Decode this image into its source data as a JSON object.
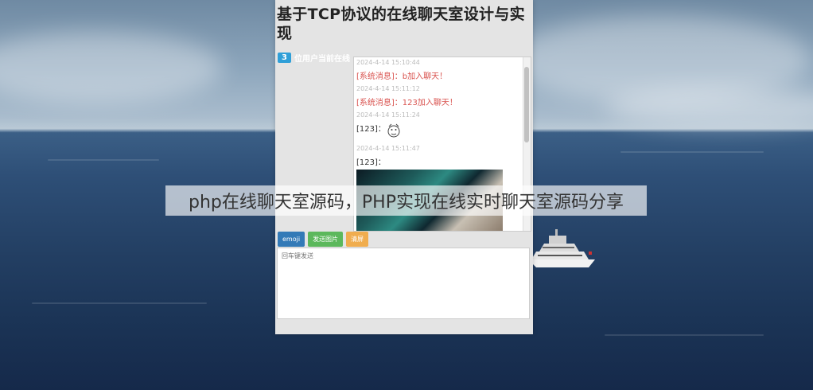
{
  "article": {
    "title": "基于TCP协议的在线聊天室设计与实现",
    "caption": "php在线聊天室源码，PHP实现在线实时聊天室源码分享"
  },
  "sidebar": {
    "online_count": "3",
    "online_label": "位用户当前在线"
  },
  "chat": {
    "messages": [
      {
        "time": "2024-4-14 15:10:44",
        "text": "[系统消息]：b加入聊天！"
      },
      {
        "time": "2024-4-14 15:11:12",
        "text": "[系统消息]：123加入聊天！"
      },
      {
        "time": "2024-4-14 15:11:24",
        "text": "[123]："
      },
      {
        "time": "2024-4-14 15:11:47",
        "text": "[123]："
      }
    ]
  },
  "toolbar": {
    "emoji_label": "emoji",
    "image_label": "发送图片",
    "clear_label": "清屏"
  },
  "input": {
    "placeholder": "回车键发送"
  },
  "colors": {
    "system_message": "#d9534f",
    "online_badge": "#2f9fd8",
    "emoji_button": "#337ab7",
    "image_button": "#5cb85c",
    "clear_button": "#f0ad4e"
  }
}
